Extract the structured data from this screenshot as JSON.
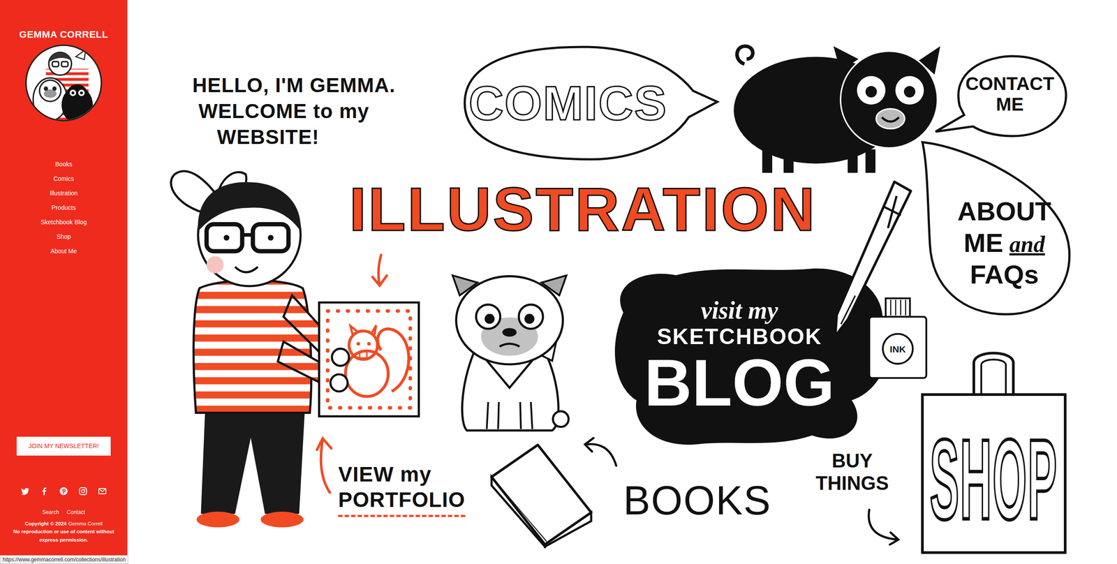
{
  "sidebar": {
    "title": "GEMMA CORRELL",
    "nav": [
      {
        "label": "Books"
      },
      {
        "label": "Comics"
      },
      {
        "label": "Illustration"
      },
      {
        "label": "Products"
      },
      {
        "label": "Sketchbook Blog"
      },
      {
        "label": "Shop"
      },
      {
        "label": "About Me"
      }
    ],
    "newsletter": "JOIN MY NEWSLETTER!",
    "links": [
      "Search",
      "Contact"
    ],
    "copyright": "Copyright © 2024",
    "owner": "Gemma Correll",
    "notice": "No reproduction or use of content without express permission."
  },
  "canvas": {
    "greeting": [
      "HELLO, I'M GEMMA.",
      "WELCOME to my",
      "WEBSITE!"
    ],
    "comics": "COMICS",
    "contact": [
      "CONTACT",
      "ME"
    ],
    "illustration": "ILLUSTRATION",
    "about": [
      "ABOUT",
      "ME",
      "and",
      "FAQs"
    ],
    "blog": [
      "visit my",
      "SKETCHBOOK",
      "BLOG"
    ],
    "ink": "INK",
    "portfolio": [
      "VIEW my",
      "PORTFOLIO"
    ],
    "books": "BOOKS",
    "buy": [
      "BUY",
      "THINGS"
    ],
    "shop": "SHOP"
  },
  "status_bar": {
    "url": "https://www.gemmacorrell.com/collections/illustration"
  }
}
